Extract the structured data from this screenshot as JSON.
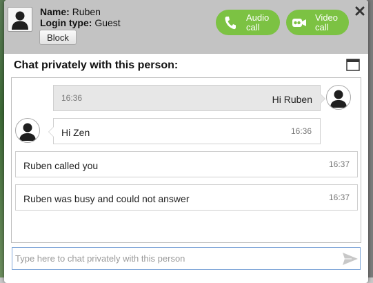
{
  "header": {
    "name_label": "Name:",
    "name_value": "Ruben",
    "login_label": "Login type:",
    "login_value": "Guest",
    "block_label": "Block",
    "audio_call_label": "Audio call",
    "video_call_label": "Video call",
    "accent_color": "#7cc243"
  },
  "chat": {
    "title": "Chat privately with this person:",
    "messages": [
      {
        "text": "Hi Ruben",
        "time": "16:36",
        "sender": "self"
      },
      {
        "text": "Hi Zen",
        "time": "16:36",
        "sender": "other"
      },
      {
        "text": "Ruben called you",
        "time": "16:37",
        "sender": "system"
      },
      {
        "text": "Ruben was busy and could not answer",
        "time": "16:37",
        "sender": "system"
      }
    ]
  },
  "composer": {
    "placeholder": "Type here to chat privately with this person",
    "value": ""
  },
  "icons": {
    "user": "user-silhouette-icon",
    "audio": "phone-icon",
    "video": "video-camera-icon",
    "close": "close-icon",
    "window": "popout-window-icon",
    "send": "send-icon"
  }
}
